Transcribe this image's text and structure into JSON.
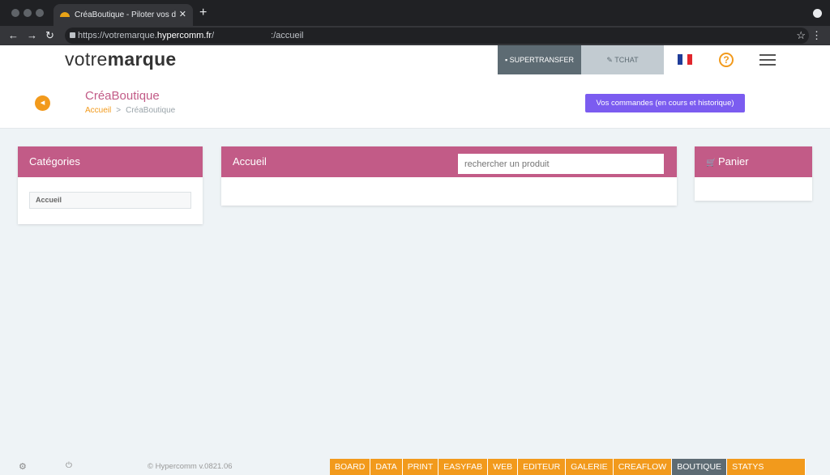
{
  "browser": {
    "tab_title": "CréaBoutique - Piloter vos don",
    "tab_close": "✕",
    "new_tab": "+",
    "url_prefix": "https://votremarque.",
    "url_domain": "hypercomm.fr",
    "url_path": "/",
    "url_suffix": ":/accueil",
    "back": "←",
    "forward": "→",
    "reload": "↻",
    "star": "☆",
    "menu": "⋮"
  },
  "header": {
    "logo_light": "votre",
    "logo_bold": "marque",
    "supertransfer_label": "SUPERTRANSFER",
    "tchat_label": "TCHAT",
    "help_label": "?",
    "flag_colors": [
      "#1f3c99",
      "#ffffff",
      "#e1262d"
    ]
  },
  "title_area": {
    "back_icon": "◂",
    "title": "CréaBoutique",
    "breadcrumb": {
      "home": "Accueil",
      "separator": ">",
      "current": "CréaBoutique"
    },
    "orders_button": "Vos commandes (en cours et historique)"
  },
  "categories": {
    "title": "Catégories",
    "items": [
      "Accueil"
    ]
  },
  "main": {
    "title": "Accueil",
    "search_placeholder": "rechercher un produit"
  },
  "cart": {
    "icon": "🛒",
    "title": "Panier"
  },
  "footer": {
    "gear": "⚙",
    "power": "⏻",
    "copyright": "© Hypercomm v.0821.06",
    "modules": [
      "BOARD",
      "DATA",
      "PRINT",
      "EASYFAB",
      "WEB",
      "EDITEUR",
      "GALERIE",
      "CREAFLOW",
      "BOUTIQUE",
      "STATYS"
    ],
    "active_module": "BOUTIQUE"
  },
  "colors": {
    "accent_pink": "#c25b87",
    "accent_orange": "#f29a1c",
    "accent_purple": "#7b5cf0",
    "slate": "#5d6b73"
  }
}
